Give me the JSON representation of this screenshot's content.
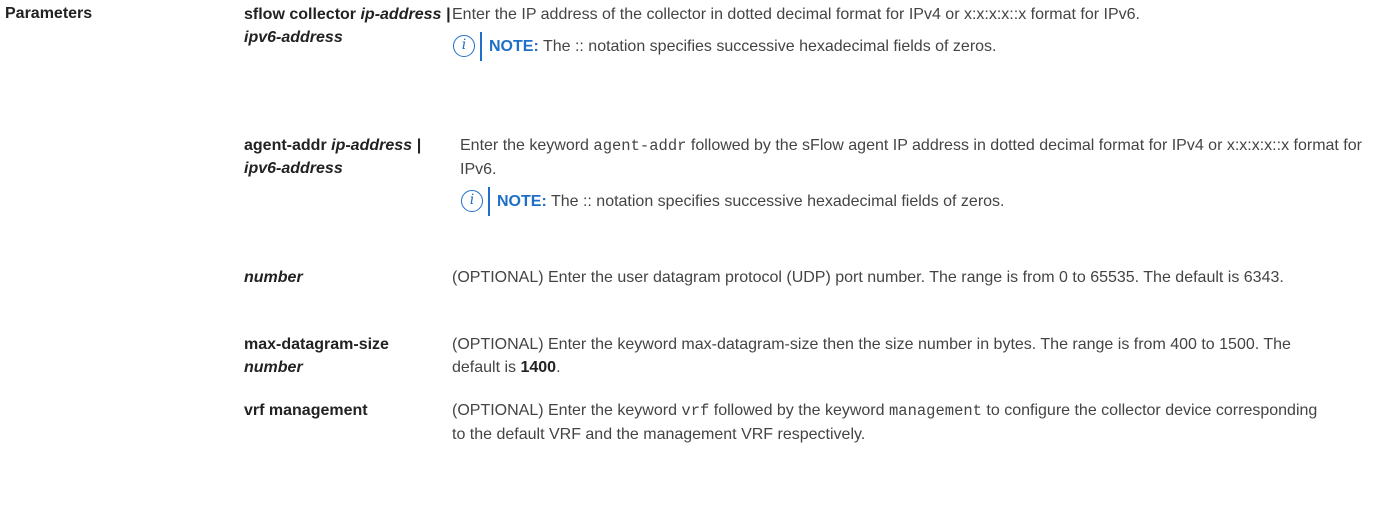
{
  "section_label": "Parameters",
  "rows": [
    {
      "term_plain": "sflow collector ",
      "term_italic": "ip-address | ipv6-address",
      "desc": "Enter the IP address of the collector in dotted decimal format for IPv4 or x:x:x:x::x format for IPv6.",
      "note_label": "NOTE:",
      "note_text": " The :: notation specifies successive hexadecimal fields of zeros."
    },
    {
      "term_plain": "agent-addr ",
      "term_italic": "ip-address | ipv6-address",
      "desc_before": "Enter the keyword ",
      "desc_code": "agent-addr",
      "desc_after": " followed by the sFlow agent IP address in dotted decimal format for IPv4 or x:x:x:x::x format for IPv6.",
      "note_label": "NOTE:",
      "note_text": " The :: notation specifies successive hexadecimal fields of zeros."
    },
    {
      "term_italic": "number",
      "desc": "(OPTIONAL) Enter the user datagram protocol (UDP) port number. The range is from 0 to 65535. The default is 6343."
    },
    {
      "term_plain": "max-datagram-size ",
      "term_italic": "number",
      "desc_before": "(OPTIONAL) Enter the keyword max-datagram-size then the size number in bytes. The range is from 400 to 1500. The default is ",
      "desc_bold": "1400",
      "desc_after": "."
    },
    {
      "term_plain": "vrf management",
      "desc_before": "(OPTIONAL) Enter the keyword ",
      "desc_code1": "vrf",
      "desc_mid": " followed by the keyword ",
      "desc_code2": "management",
      "desc_after": " to configure the collector device corresponding to the default VRF and the management VRF respectively."
    }
  ],
  "icons": {
    "note": "info-icon",
    "note_color": "#1e6fc7"
  }
}
